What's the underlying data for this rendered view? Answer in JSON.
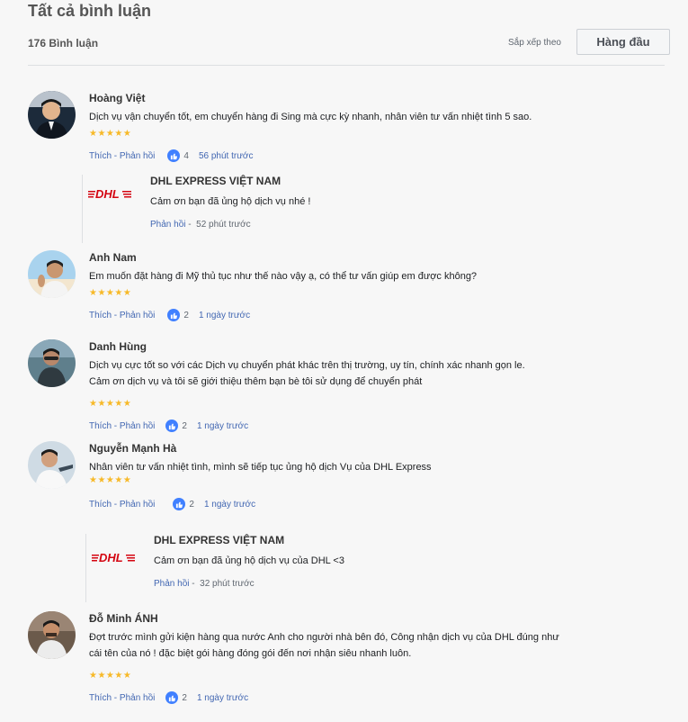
{
  "header": {
    "title": "Tất cả bình luận",
    "count": "176 Bình luận",
    "sort_label": "Sắp xếp theo",
    "sort_value": "Hàng đầu"
  },
  "colors": {
    "link": "#4267b2",
    "star": "#f7b928",
    "like": "#4080ff",
    "dhl_red": "#d40511"
  },
  "comments": [
    {
      "name": "Hoàng Việt",
      "lines": [
        "Dịch vụ vận chuyển tốt, em chuyển hàng đi Sing mà cực kỳ nhanh, nhân viên tư vấn nhiệt tình 5 sao."
      ],
      "stars": "★★★★★",
      "actions": "Thích - Phản hồi",
      "likes": "4",
      "time": "56 phút trước"
    },
    {
      "name": "Anh Nam",
      "lines": [
        "Em muốn đặt hàng đi Mỹ thủ tục như thế nào vậy ạ, có thể tư vấn giúp em được không?"
      ],
      "stars": "★★★★★",
      "actions": "Thích - Phản hồi",
      "likes": "2",
      "time": "1 ngày trước"
    },
    {
      "name": "Danh Hùng",
      "lines": [
        "Dịch vụ cực tốt so với các Dịch vụ chuyển phát khác trên thị trường, uy tín, chính xác nhanh gọn le.",
        "Cảm ơn dịch vụ và tôi sẽ giới thiệu thêm bạn bè tôi sử dụng để chuyển phát"
      ],
      "stars": "★★★★★",
      "actions": "Thích - Phản hồi",
      "likes": "2",
      "time": "1 ngày trước"
    },
    {
      "name": "Nguyễn Mạnh Hà",
      "lines": [
        "Nhân viên tư vấn nhiệt tình, mình sẽ tiếp tục ủng hộ dịch Vụ của DHL Express"
      ],
      "stars": "★★★★★",
      "actions": "Thích - Phản hồi",
      "likes": "2",
      "time": "1 ngày trước"
    },
    {
      "name": "Đỗ Minh ÁNH",
      "lines": [
        "Đợt trước mình gửi kiện hàng qua nước Anh cho người nhà bên đó, Công nhận dịch vụ của DHL đúng như",
        "cái tên của nó ! đặc biệt gói hàng đóng gói đến nơi nhận siêu nhanh luôn."
      ],
      "stars": "★★★★★",
      "actions": "Thích - Phản hồi",
      "likes": "2",
      "time": "1 ngày trước"
    }
  ],
  "replies": [
    {
      "logo": "DHL",
      "name": "DHL EXPRESS VIỆT NAM",
      "text": "Cảm ơn bạn đã ủng hộ dịch vụ nhé !",
      "action": "Phản hồi",
      "time": "52 phút trước"
    },
    {
      "logo": "DHL",
      "name": "DHL EXPRESS VIỆT NAM",
      "text": "Cảm ơn bạn đã ủng hộ dịch vụ của DHL <3",
      "action": "Phản hồi",
      "time": "32 phút trước"
    }
  ]
}
